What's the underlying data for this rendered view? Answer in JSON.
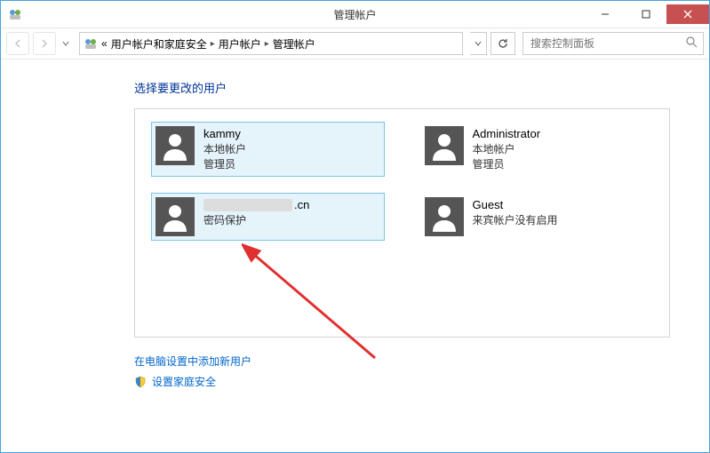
{
  "titlebar": {
    "title": "管理帐户"
  },
  "nav": {
    "crumb_prefix": "«",
    "crumb1": "用户帐户和家庭安全",
    "crumb2": "用户帐户",
    "crumb3": "管理帐户",
    "search_placeholder": "搜索控制面板"
  },
  "main": {
    "heading": "选择要更改的用户",
    "link_add": "在电脑设置中添加新用户",
    "link_family": "设置家庭安全"
  },
  "users": [
    {
      "name": "kammy",
      "line2": "本地帐户",
      "line3": "管理员",
      "selected": true
    },
    {
      "name": "Administrator",
      "line2": "本地帐户",
      "line3": "管理员",
      "selected": false
    },
    {
      "name_suffix": ".cn",
      "line2": "密码保护",
      "line3": "",
      "selected": true,
      "obscured": true
    },
    {
      "name": "Guest",
      "line2": "来宾帐户没有启用",
      "line3": "",
      "selected": false
    }
  ]
}
